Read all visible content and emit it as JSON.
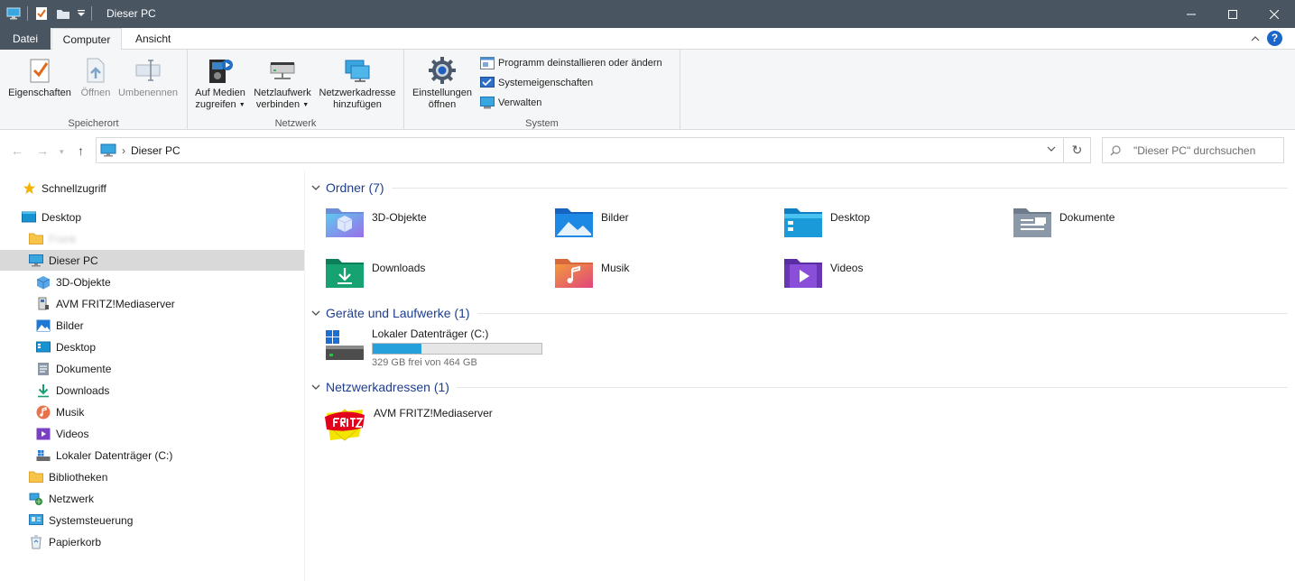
{
  "window": {
    "title": "Dieser PC"
  },
  "ribbon_tabs": {
    "file": "Datei",
    "computer": "Computer",
    "view": "Ansicht"
  },
  "ribbon": {
    "location": {
      "label": "Speicherort",
      "properties": "Eigenschaften",
      "open": "Öffnen",
      "rename": "Umbenennen"
    },
    "network": {
      "label": "Netzwerk",
      "media_1": "Auf Medien",
      "media_2": "zugreifen",
      "drive_1": "Netzlaufwerk",
      "drive_2": "verbinden",
      "addr_1": "Netzwerkadresse",
      "addr_2": "hinzufügen"
    },
    "system": {
      "label": "System",
      "settings_1": "Einstellungen",
      "settings_2": "öffnen",
      "uninstall": "Programm deinstallieren oder ändern",
      "sysprops": "Systemeigenschaften",
      "manage": "Verwalten"
    }
  },
  "address": {
    "path": "Dieser PC",
    "search_placeholder": "\"Dieser PC\" durchsuchen"
  },
  "nav": {
    "quick": "Schnellzugriff",
    "desktop_root": "Desktop",
    "user": "Frank",
    "this_pc": "Dieser PC",
    "objects3d": "3D-Objekte",
    "fritz": "AVM FRITZ!Mediaserver",
    "pictures": "Bilder",
    "desktop": "Desktop",
    "documents": "Dokumente",
    "downloads": "Downloads",
    "music": "Musik",
    "videos": "Videos",
    "local_disk": "Lokaler Datenträger (C:)",
    "libraries": "Bibliotheken",
    "network": "Netzwerk",
    "control_panel": "Systemsteuerung",
    "recycle_bin": "Papierkorb"
  },
  "content": {
    "folders_header": "Ordner (7)",
    "folders": {
      "objects3d": "3D-Objekte",
      "pictures": "Bilder",
      "desktop": "Desktop",
      "documents": "Dokumente",
      "downloads": "Downloads",
      "music": "Musik",
      "videos": "Videos"
    },
    "devices_header": "Geräte und Laufwerke (1)",
    "drive": {
      "name": "Lokaler Datenträger (C:)",
      "free": "329 GB frei von 464 GB",
      "used_fraction": 0.291
    },
    "network_header": "Netzwerkadressen (1)",
    "network_item": "AVM FRITZ!Mediaserver"
  },
  "colors": {
    "titlebar": "#4a5562",
    "accent": "#1e3d8f",
    "drive_fill": "#26a0da",
    "selection": "#d9d9d9"
  }
}
